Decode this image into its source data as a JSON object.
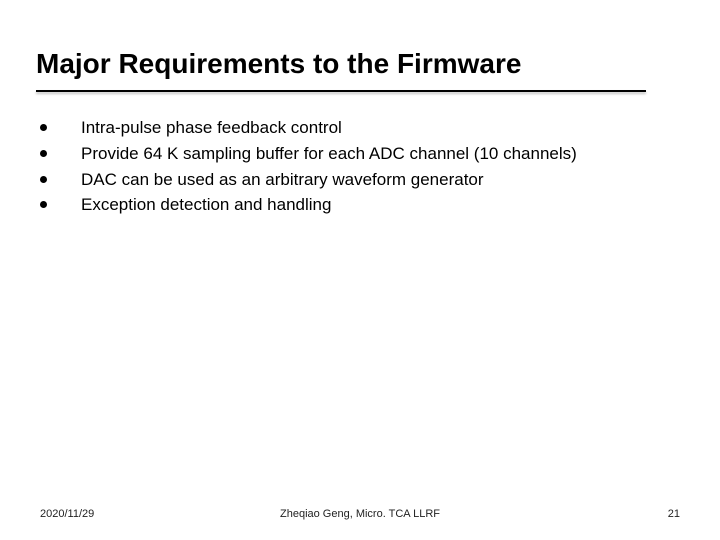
{
  "title": "Major Requirements to the Firmware",
  "bullets": [
    "Intra-pulse phase feedback control",
    "Provide 64 K sampling buffer for each ADC channel (10 channels)",
    "DAC can be used as an arbitrary waveform generator",
    "Exception detection and handling"
  ],
  "footer": {
    "date": "2020/11/29",
    "center": "Zheqiao Geng, Micro. TCA LLRF",
    "page": "21"
  }
}
